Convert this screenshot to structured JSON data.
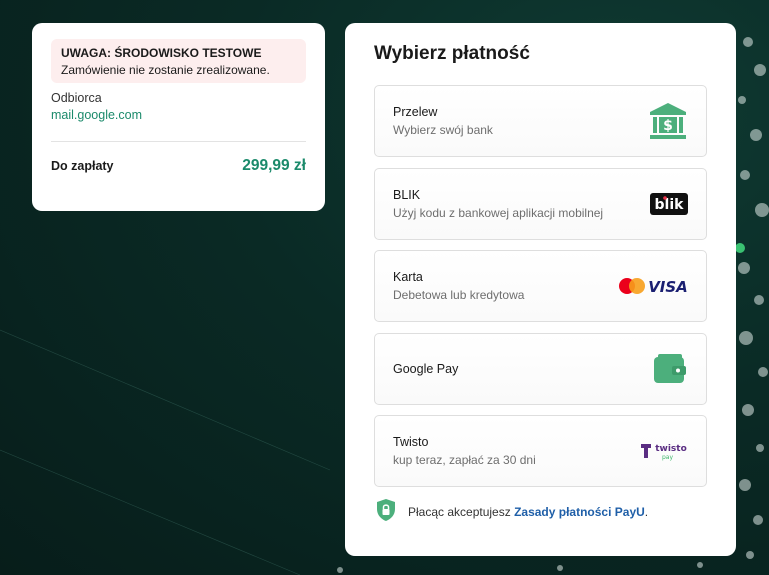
{
  "summary": {
    "warning_title": "UWAGA: ŚRODOWISKO TESTOWE",
    "warning_text": "Zamówienie nie zostanie zrealizowane.",
    "recipient_label": "Odbiorca",
    "recipient_value": "mail.google.com",
    "total_label": "Do zapłaty",
    "total_amount": "299,99 zł"
  },
  "payment": {
    "title": "Wybierz płatność",
    "methods": [
      {
        "name": "Przelew",
        "desc": "Wybierz swój bank",
        "icon": "bank-icon"
      },
      {
        "name": "BLIK",
        "desc": "Użyj kodu z bankowej aplikacji mobilnej",
        "icon": "blik-logo",
        "logo_text": "blik"
      },
      {
        "name": "Karta",
        "desc": "Debetowa lub kredytowa",
        "icon": "mastercard-visa-logo",
        "logo_text": "VISA"
      },
      {
        "name": "Google Pay",
        "desc": "",
        "icon": "wallet-icon"
      },
      {
        "name": "Twisto",
        "desc": "kup teraz, zapłać za 30 dni",
        "icon": "twisto-logo",
        "logo_text": "twisto",
        "logo_subtext": "pay"
      }
    ],
    "footer_text": "Płacąc akceptujesz ",
    "footer_link": "Zasady płatności PayU",
    "footer_end": "."
  },
  "colors": {
    "accent": "#1b8a6b",
    "icon_green": "#4caf7c",
    "link": "#1f5fa8",
    "warning_bg": "#fdeeee",
    "twisto_purple": "#5a2d82"
  }
}
